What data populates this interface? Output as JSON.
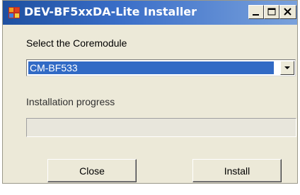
{
  "window": {
    "title": "DEV-BF5xxDA-Lite Installer",
    "controls": {
      "minimize_icon": "minimize-icon",
      "maximize_icon": "maximize-icon",
      "close_icon": "close-icon"
    }
  },
  "coremodule": {
    "label": "Select the Coremodule",
    "selected": "CM-BF533"
  },
  "progress": {
    "label": "Installation progress",
    "value": 0
  },
  "buttons": {
    "close": "Close",
    "install": "Install"
  },
  "colors": {
    "titlebar_start": "#1e50a0",
    "titlebar_end": "#7aa2dc",
    "selection": "#316ac5",
    "face": "#ece9d8"
  }
}
